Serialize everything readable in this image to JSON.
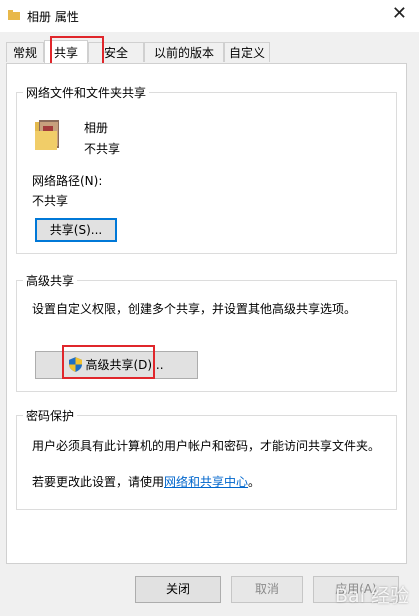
{
  "window": {
    "title": "相册 属性",
    "close_glyph": "✕"
  },
  "tabs": [
    {
      "label": "常规",
      "active": false
    },
    {
      "label": "共享",
      "active": true
    },
    {
      "label": "安全",
      "active": false
    },
    {
      "label": "以前的版本",
      "active": false
    },
    {
      "label": "自定义",
      "active": false
    }
  ],
  "network_sharing": {
    "heading": "网络文件和文件夹共享",
    "folder_name": "相册",
    "share_status": "不共享",
    "path_label": "网络路径(N):",
    "path_value": "不共享",
    "share_button": "共享(S)..."
  },
  "advanced_sharing": {
    "heading": "高级共享",
    "description": "设置自定义权限，创建多个共享，并设置其他高级共享选项。",
    "button": "高级共享(D)..."
  },
  "password_protection": {
    "heading": "密码保护",
    "line1": "用户必须具有此计算机的用户帐户和密码，才能访问共享文件夹。",
    "line2_prefix": "若要更改此设置，请使用",
    "line2_link": "网络和共享中心",
    "line2_suffix": "。"
  },
  "footer": {
    "ok": "关闭",
    "cancel": "取消",
    "apply": "应用(A)"
  },
  "watermark": "Bai 经验",
  "colors": {
    "accent_blue": "#0078d7",
    "highlight_red": "#e0262b",
    "link_blue": "#0066cc"
  }
}
